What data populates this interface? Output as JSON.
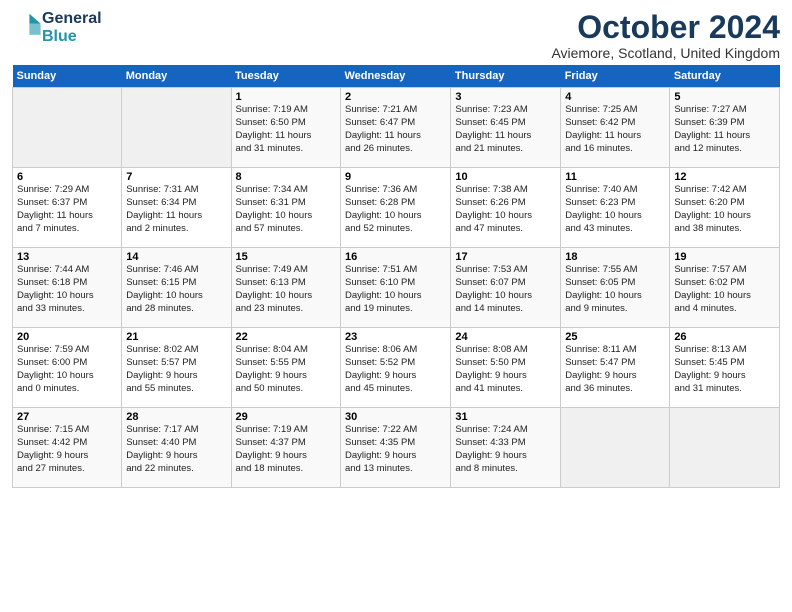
{
  "logo": {
    "line1": "General",
    "line2": "Blue"
  },
  "title": "October 2024",
  "subtitle": "Aviemore, Scotland, United Kingdom",
  "days_of_week": [
    "Sunday",
    "Monday",
    "Tuesday",
    "Wednesday",
    "Thursday",
    "Friday",
    "Saturday"
  ],
  "weeks": [
    [
      {
        "day": "",
        "detail": ""
      },
      {
        "day": "",
        "detail": ""
      },
      {
        "day": "1",
        "detail": "Sunrise: 7:19 AM\nSunset: 6:50 PM\nDaylight: 11 hours\nand 31 minutes."
      },
      {
        "day": "2",
        "detail": "Sunrise: 7:21 AM\nSunset: 6:47 PM\nDaylight: 11 hours\nand 26 minutes."
      },
      {
        "day": "3",
        "detail": "Sunrise: 7:23 AM\nSunset: 6:45 PM\nDaylight: 11 hours\nand 21 minutes."
      },
      {
        "day": "4",
        "detail": "Sunrise: 7:25 AM\nSunset: 6:42 PM\nDaylight: 11 hours\nand 16 minutes."
      },
      {
        "day": "5",
        "detail": "Sunrise: 7:27 AM\nSunset: 6:39 PM\nDaylight: 11 hours\nand 12 minutes."
      }
    ],
    [
      {
        "day": "6",
        "detail": "Sunrise: 7:29 AM\nSunset: 6:37 PM\nDaylight: 11 hours\nand 7 minutes."
      },
      {
        "day": "7",
        "detail": "Sunrise: 7:31 AM\nSunset: 6:34 PM\nDaylight: 11 hours\nand 2 minutes."
      },
      {
        "day": "8",
        "detail": "Sunrise: 7:34 AM\nSunset: 6:31 PM\nDaylight: 10 hours\nand 57 minutes."
      },
      {
        "day": "9",
        "detail": "Sunrise: 7:36 AM\nSunset: 6:28 PM\nDaylight: 10 hours\nand 52 minutes."
      },
      {
        "day": "10",
        "detail": "Sunrise: 7:38 AM\nSunset: 6:26 PM\nDaylight: 10 hours\nand 47 minutes."
      },
      {
        "day": "11",
        "detail": "Sunrise: 7:40 AM\nSunset: 6:23 PM\nDaylight: 10 hours\nand 43 minutes."
      },
      {
        "day": "12",
        "detail": "Sunrise: 7:42 AM\nSunset: 6:20 PM\nDaylight: 10 hours\nand 38 minutes."
      }
    ],
    [
      {
        "day": "13",
        "detail": "Sunrise: 7:44 AM\nSunset: 6:18 PM\nDaylight: 10 hours\nand 33 minutes."
      },
      {
        "day": "14",
        "detail": "Sunrise: 7:46 AM\nSunset: 6:15 PM\nDaylight: 10 hours\nand 28 minutes."
      },
      {
        "day": "15",
        "detail": "Sunrise: 7:49 AM\nSunset: 6:13 PM\nDaylight: 10 hours\nand 23 minutes."
      },
      {
        "day": "16",
        "detail": "Sunrise: 7:51 AM\nSunset: 6:10 PM\nDaylight: 10 hours\nand 19 minutes."
      },
      {
        "day": "17",
        "detail": "Sunrise: 7:53 AM\nSunset: 6:07 PM\nDaylight: 10 hours\nand 14 minutes."
      },
      {
        "day": "18",
        "detail": "Sunrise: 7:55 AM\nSunset: 6:05 PM\nDaylight: 10 hours\nand 9 minutes."
      },
      {
        "day": "19",
        "detail": "Sunrise: 7:57 AM\nSunset: 6:02 PM\nDaylight: 10 hours\nand 4 minutes."
      }
    ],
    [
      {
        "day": "20",
        "detail": "Sunrise: 7:59 AM\nSunset: 6:00 PM\nDaylight: 10 hours\nand 0 minutes."
      },
      {
        "day": "21",
        "detail": "Sunrise: 8:02 AM\nSunset: 5:57 PM\nDaylight: 9 hours\nand 55 minutes."
      },
      {
        "day": "22",
        "detail": "Sunrise: 8:04 AM\nSunset: 5:55 PM\nDaylight: 9 hours\nand 50 minutes."
      },
      {
        "day": "23",
        "detail": "Sunrise: 8:06 AM\nSunset: 5:52 PM\nDaylight: 9 hours\nand 45 minutes."
      },
      {
        "day": "24",
        "detail": "Sunrise: 8:08 AM\nSunset: 5:50 PM\nDaylight: 9 hours\nand 41 minutes."
      },
      {
        "day": "25",
        "detail": "Sunrise: 8:11 AM\nSunset: 5:47 PM\nDaylight: 9 hours\nand 36 minutes."
      },
      {
        "day": "26",
        "detail": "Sunrise: 8:13 AM\nSunset: 5:45 PM\nDaylight: 9 hours\nand 31 minutes."
      }
    ],
    [
      {
        "day": "27",
        "detail": "Sunrise: 7:15 AM\nSunset: 4:42 PM\nDaylight: 9 hours\nand 27 minutes."
      },
      {
        "day": "28",
        "detail": "Sunrise: 7:17 AM\nSunset: 4:40 PM\nDaylight: 9 hours\nand 22 minutes."
      },
      {
        "day": "29",
        "detail": "Sunrise: 7:19 AM\nSunset: 4:37 PM\nDaylight: 9 hours\nand 18 minutes."
      },
      {
        "day": "30",
        "detail": "Sunrise: 7:22 AM\nSunset: 4:35 PM\nDaylight: 9 hours\nand 13 minutes."
      },
      {
        "day": "31",
        "detail": "Sunrise: 7:24 AM\nSunset: 4:33 PM\nDaylight: 9 hours\nand 8 minutes."
      },
      {
        "day": "",
        "detail": ""
      },
      {
        "day": "",
        "detail": ""
      }
    ]
  ]
}
